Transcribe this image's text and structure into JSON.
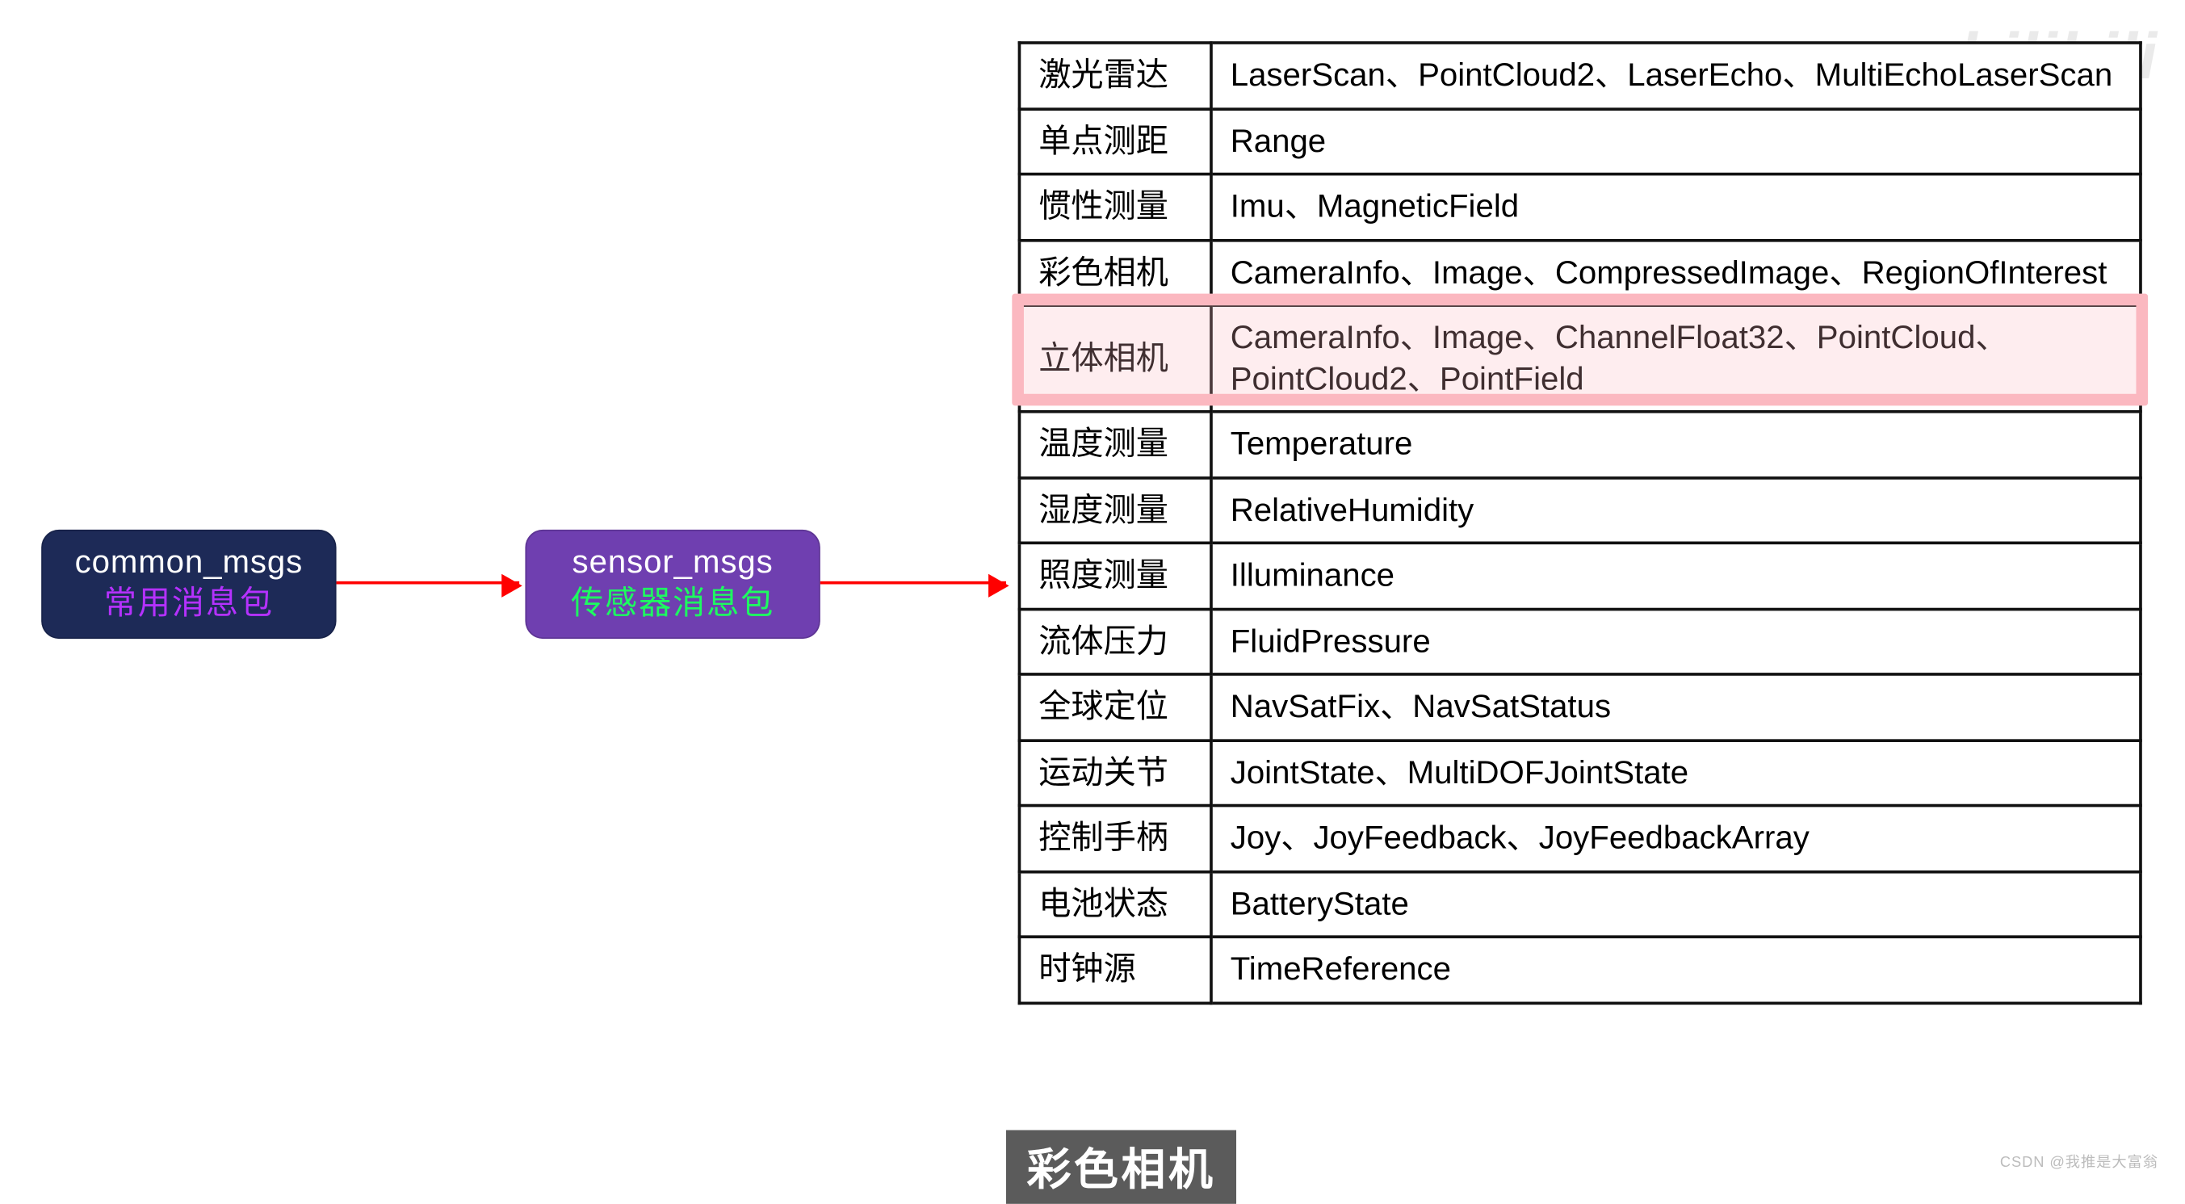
{
  "boxes": {
    "common": {
      "title": "common_msgs",
      "sub": "常用消息包"
    },
    "sensor": {
      "title": "sensor_msgs",
      "sub": "传感器消息包"
    }
  },
  "table": {
    "rows": [
      {
        "label": "激光雷达",
        "value": "LaserScan、PointCloud2、LaserEcho、MultiEchoLaserScan"
      },
      {
        "label": "单点测距",
        "value": "Range"
      },
      {
        "label": "惯性测量",
        "value": "Imu、MagneticField"
      },
      {
        "label": "彩色相机",
        "value": "CameraInfo、Image、CompressedImage、RegionOfInterest"
      },
      {
        "label": "立体相机",
        "value": "CameraInfo、Image、ChannelFloat32、PointCloud、PointCloud2、PointField"
      },
      {
        "label": "温度测量",
        "value": "Temperature"
      },
      {
        "label": "湿度测量",
        "value": "RelativeHumidity"
      },
      {
        "label": "照度测量",
        "value": "Illuminance"
      },
      {
        "label": "流体压力",
        "value": "FluidPressure"
      },
      {
        "label": "全球定位",
        "value": "NavSatFix、NavSatStatus"
      },
      {
        "label": "运动关节",
        "value": "JointState、MultiDOFJointState"
      },
      {
        "label": "控制手柄",
        "value": "Joy、JoyFeedback、JoyFeedbackArray"
      },
      {
        "label": "电池状态",
        "value": "BatteryState"
      },
      {
        "label": "时钟源",
        "value": "TimeReference"
      }
    ],
    "highlighted_index": 3
  },
  "caption": "彩色相机",
  "watermark_top": "bilibili",
  "watermark_bottom": "CSDN @我推是大富翁",
  "colors": {
    "common_bg": "#1d2a57",
    "sensor_bg": "#6f3fb0",
    "highlight": "#fbb8c0",
    "arrow": "#ff0000"
  }
}
